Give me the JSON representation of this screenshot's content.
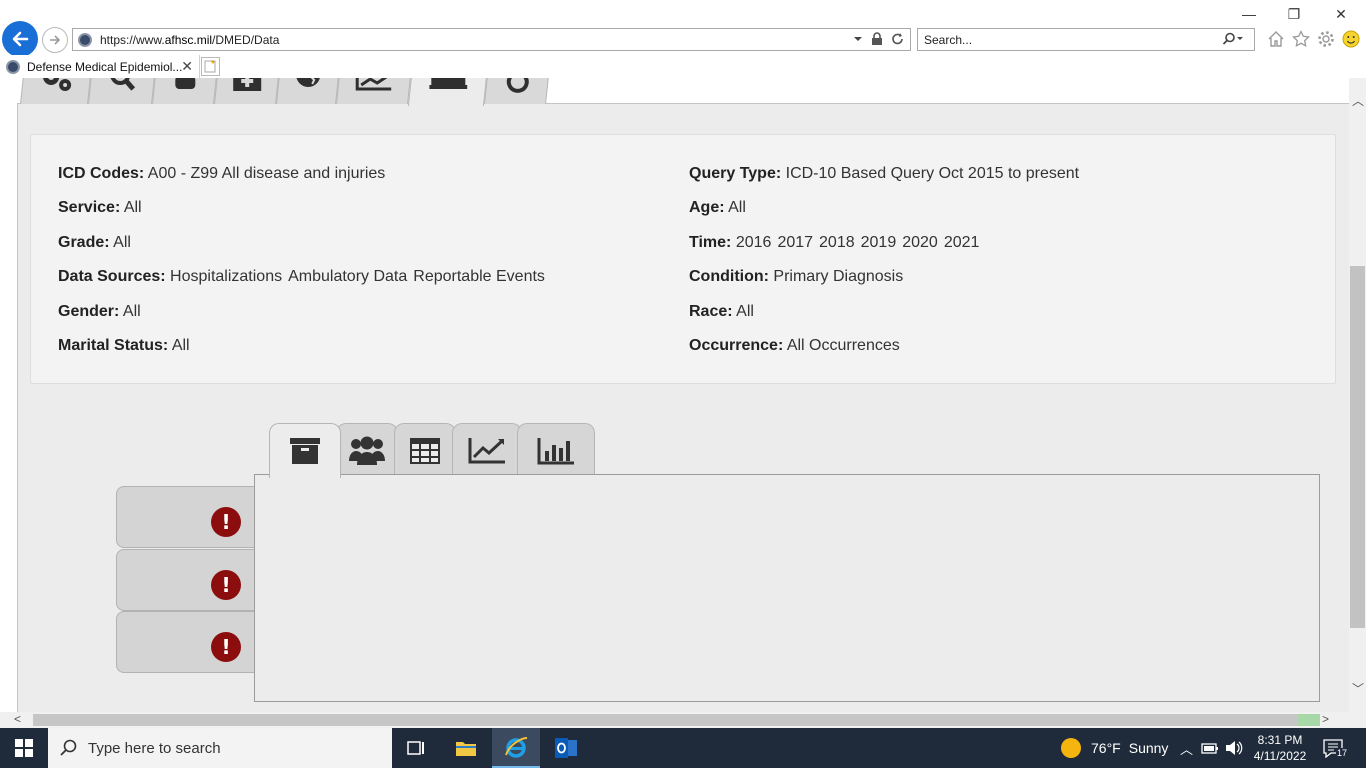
{
  "browser": {
    "url_prefix": "https://www.",
    "url_host": "afhsc.mil",
    "url_path": "/DMED/Data",
    "search_placeholder": "Search...",
    "tab_title": "Defense Medical Epidemiol...",
    "tab_close": "✕"
  },
  "window": {
    "minimize": "—",
    "restore": "❐",
    "close": "✕"
  },
  "summary": {
    "icd_label": "ICD Codes:",
    "icd_value": "A00 - Z99 All disease and injuries",
    "service_label": "Service:",
    "service_value": "All",
    "grade_label": "Grade:",
    "grade_value": "All",
    "sources_label": "Data Sources:",
    "sources": [
      "Hospitalizations",
      "Ambulatory Data",
      "Reportable Events"
    ],
    "gender_label": "Gender:",
    "gender_value": "All",
    "marital_label": "Marital Status:",
    "marital_value": "All",
    "query_label": "Query Type:",
    "query_value": "ICD-10 Based Query Oct 2015 to present",
    "age_label": "Age:",
    "age_value": "All",
    "time_label": "Time:",
    "years": [
      "2016",
      "2017",
      "2018",
      "2019",
      "2020",
      "2021"
    ],
    "condition_label": "Condition:",
    "condition_value": "Primary Diagnosis",
    "race_label": "Race:",
    "race_value": "All",
    "occurrence_label": "Occurrence:",
    "occurrence_value": "All Occurrences"
  },
  "top_tabs": [
    "gears-icon",
    "search-icon",
    "person-icon",
    "medical-icon",
    "globe-icon",
    "line-chart-icon",
    "archive-icon",
    "undo-icon"
  ],
  "inner_tabs": [
    "archive-icon",
    "users-icon",
    "table-icon",
    "line-chart-icon",
    "bar-chart-icon"
  ],
  "side_tabs": [
    "warning-icon",
    "warning-icon",
    "warning-icon"
  ],
  "taskbar": {
    "search_placeholder": "Type here to search",
    "weather_temp": "76°F",
    "weather_text": "Sunny",
    "time": "8:31 PM",
    "date": "4/11/2022",
    "notifications": "17"
  },
  "colors": {
    "back_button": "#1a6fd6",
    "warning": "#8b0d0d",
    "taskbar": "#1f2b3a"
  }
}
